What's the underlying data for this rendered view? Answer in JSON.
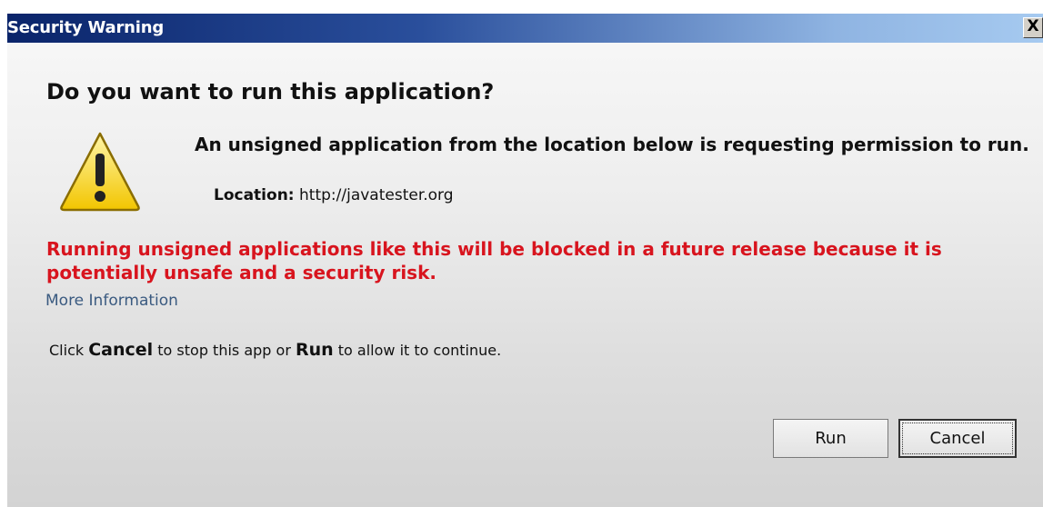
{
  "window": {
    "title": "Security Warning",
    "close_label": "X"
  },
  "dialog": {
    "headline": "Do you want to run this application?",
    "message": "An unsigned application from the location below is requesting permission to run.",
    "location_label": "Location:",
    "location_value": "http://javatester.org",
    "red_warning": "Running unsigned applications like this will be blocked in a future release because it is potentially unsafe and a security risk.",
    "more_info": "More Information",
    "instruction": {
      "click": "Click",
      "cancel_word": "Cancel",
      "middle": "to stop this app or",
      "run_word": "Run",
      "end": "to allow it to continue."
    }
  },
  "buttons": {
    "run": "Run",
    "cancel": "Cancel"
  },
  "icons": {
    "warning": "warning-triangle-icon"
  },
  "colors": {
    "warning_text": "#d8141e",
    "link": "#3a5a80",
    "titlebar_start": "#0a246a",
    "titlebar_end": "#a6caf0"
  }
}
